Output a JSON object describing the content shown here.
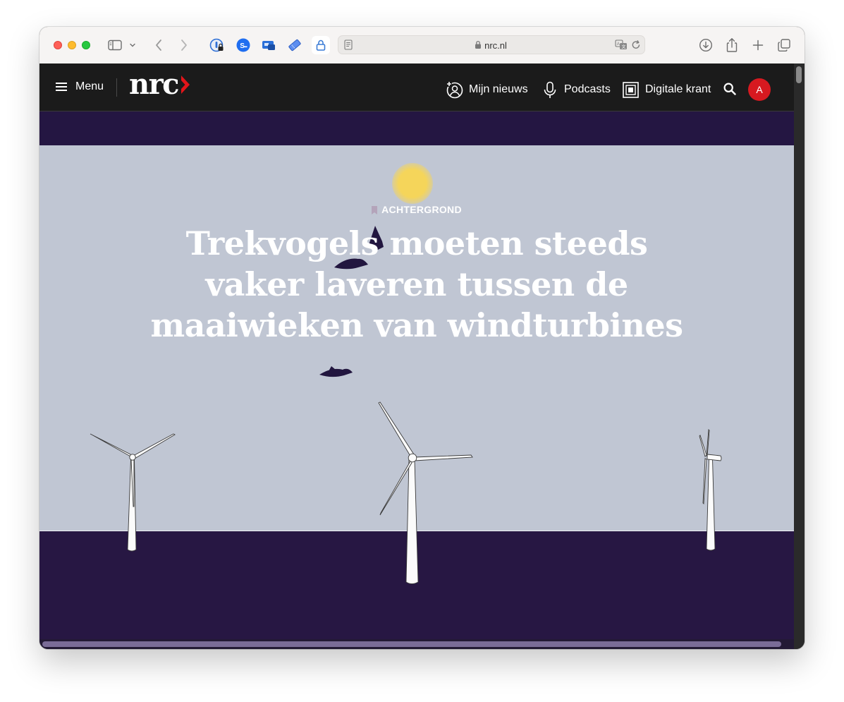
{
  "browser": {
    "url": "nrc.nl"
  },
  "header": {
    "menu_label": "Menu",
    "logo_text": "nrc",
    "nav": [
      {
        "label": "Mijn nieuws"
      },
      {
        "label": "Podcasts"
      },
      {
        "label": "Digitale krant"
      }
    ],
    "avatar_letter": "A"
  },
  "article": {
    "kicker": "ACHTERGROND",
    "headline": "Trekvogels moeten steeds vaker laveren tussen de maaiwieken van windturbines"
  },
  "colors": {
    "header_bg": "#1b1b1b",
    "sky": "#c0c6d3",
    "sea": "#271743",
    "brand_red": "#e3151a",
    "avatar_red": "#d71920",
    "sun": "#f5d55a"
  }
}
